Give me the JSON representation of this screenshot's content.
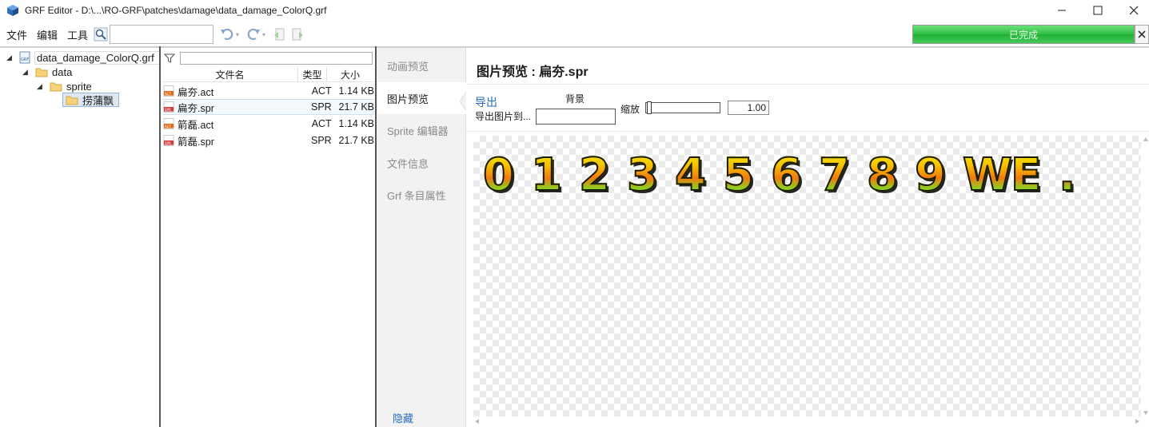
{
  "window": {
    "title": "GRF Editor - D:\\...\\RO-GRF\\patches\\damage\\data_damage_ColorQ.grf"
  },
  "menu": {
    "items": [
      "文件",
      "编辑",
      "工具"
    ],
    "search_value": ""
  },
  "progress": {
    "label": "已完成",
    "percent": 100
  },
  "tree": {
    "root": "data_damage_ColorQ.grf",
    "data": "data",
    "sprite": "sprite",
    "selected": "捞蒲飘"
  },
  "file_list": {
    "filter_value": "",
    "headers": {
      "name": "文件名",
      "type": "类型",
      "size": "大小"
    },
    "rows": [
      {
        "name": "扁夯.act",
        "type": "ACT",
        "size": "1.14 KB",
        "kind": "act"
      },
      {
        "name": "扁夯.spr",
        "type": "SPR",
        "size": "21.7 KB",
        "kind": "spr"
      },
      {
        "name": "箭磊.act",
        "type": "ACT",
        "size": "1.14 KB",
        "kind": "act"
      },
      {
        "name": "箭磊.spr",
        "type": "SPR",
        "size": "21.7 KB",
        "kind": "spr"
      }
    ]
  },
  "side_tabs": {
    "items": [
      "动画预览",
      "图片预览",
      "Sprite 编辑器",
      "文件信息",
      "Grf 条目属性"
    ],
    "active_index": 1,
    "hide_label": "隐藏"
  },
  "preview": {
    "title": "图片预览 : 扁夯.spr",
    "export_link": "导出",
    "export_to": "导出图片到...",
    "bg_label": "背景",
    "zoom_label": "缩放",
    "zoom_value": "1.00",
    "sprite_glyphs": [
      "0",
      "1",
      "2",
      "3",
      "4",
      "5",
      "6",
      "7",
      "8",
      "9",
      "W",
      "E",
      "."
    ]
  }
}
